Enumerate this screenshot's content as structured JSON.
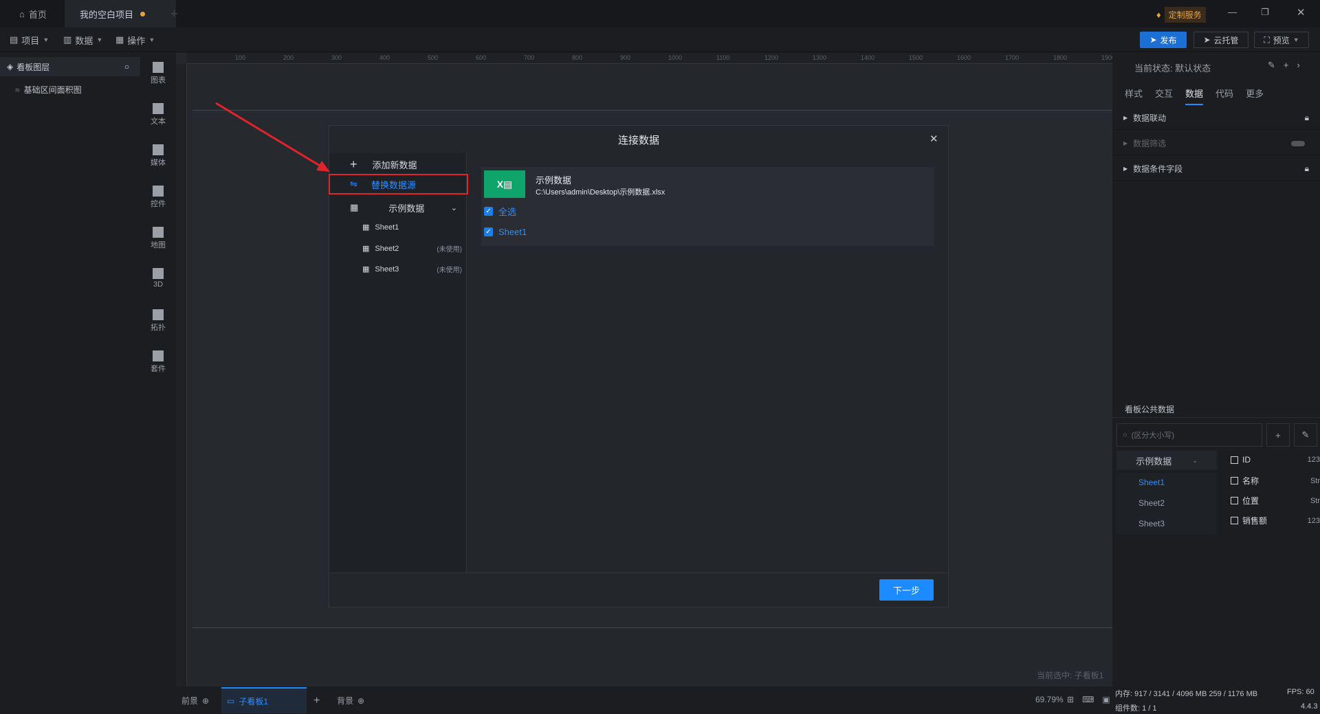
{
  "tabs": {
    "home": "首页",
    "project": "我的空白项目"
  },
  "header_right": {
    "custom_service": "定制服务"
  },
  "menus": {
    "project": "项目",
    "data": "数据",
    "operate": "操作"
  },
  "actions": {
    "publish": "发布",
    "cloud_host": "云托管",
    "preview": "预览"
  },
  "layers": {
    "title": "看板图层",
    "item": "基础区间面积图"
  },
  "sidebar": [
    {
      "label": "图表",
      "icon": "chart-icon"
    },
    {
      "label": "文本",
      "icon": "text-icon"
    },
    {
      "label": "媒体",
      "icon": "media-icon"
    },
    {
      "label": "控件",
      "icon": "widget-icon"
    },
    {
      "label": "地图",
      "icon": "map-icon"
    },
    {
      "label": "3D",
      "icon": "cube-icon"
    },
    {
      "label": "拓扑",
      "icon": "topology-icon"
    },
    {
      "label": "套件",
      "icon": "kit-icon"
    }
  ],
  "ruler_ticks": [
    "100",
    "200",
    "300",
    "400",
    "500",
    "600",
    "700",
    "800",
    "900",
    "1000",
    "1100",
    "1200",
    "1300",
    "1400",
    "1500",
    "1600",
    "1700",
    "1800",
    "1900"
  ],
  "canvas": {
    "selected_text": "当前选中: 子看板1"
  },
  "bottom": {
    "foreground": "前景",
    "subboard": "子看板1",
    "background": "背景",
    "zoom": "69.79%"
  },
  "right_panel": {
    "state_label": "当前状态: 默认状态",
    "tabs": [
      "样式",
      "交互",
      "数据",
      "代码",
      "更多"
    ],
    "active_tab": "数据",
    "rows": [
      "数据联动",
      "数据筛选",
      "数据条件字段"
    ],
    "public_data_title": "看板公共数据",
    "search_placeholder": "(区分大小写)",
    "dataset_name": "示例数据",
    "sheets": [
      "Sheet1",
      "Sheet2",
      "Sheet3"
    ],
    "active_sheet": "Sheet1",
    "fields": [
      {
        "name": "ID",
        "type": "123"
      },
      {
        "name": "名称",
        "type": "Str"
      },
      {
        "name": "位置",
        "type": "Str"
      },
      {
        "name": "销售额",
        "type": "123"
      }
    ]
  },
  "status": {
    "memory": "内存: 917 / 3141 / 4096 MB 259 / 1176 MB",
    "fps": "FPS: 60",
    "components": "组件数: 1 / 1",
    "version": "4.4.3"
  },
  "modal": {
    "title": "连接数据",
    "add_new": "添加新数据",
    "replace_source": "替换数据源",
    "dataset": "示例数据",
    "sheets": [
      {
        "name": "Sheet1",
        "status": ""
      },
      {
        "name": "Sheet2",
        "status": "(未使用)"
      },
      {
        "name": "Sheet3",
        "status": "(未使用)"
      }
    ],
    "file_name": "示例数据",
    "file_path": "C:\\Users\\admin\\Desktop\\示例数据.xlsx",
    "select_all": "全选",
    "checked_sheet": "Sheet1",
    "next": "下一步"
  },
  "colors": {
    "accent": "#1c8bff",
    "highlight": "#e0242a",
    "excel": "#0fa56a"
  }
}
